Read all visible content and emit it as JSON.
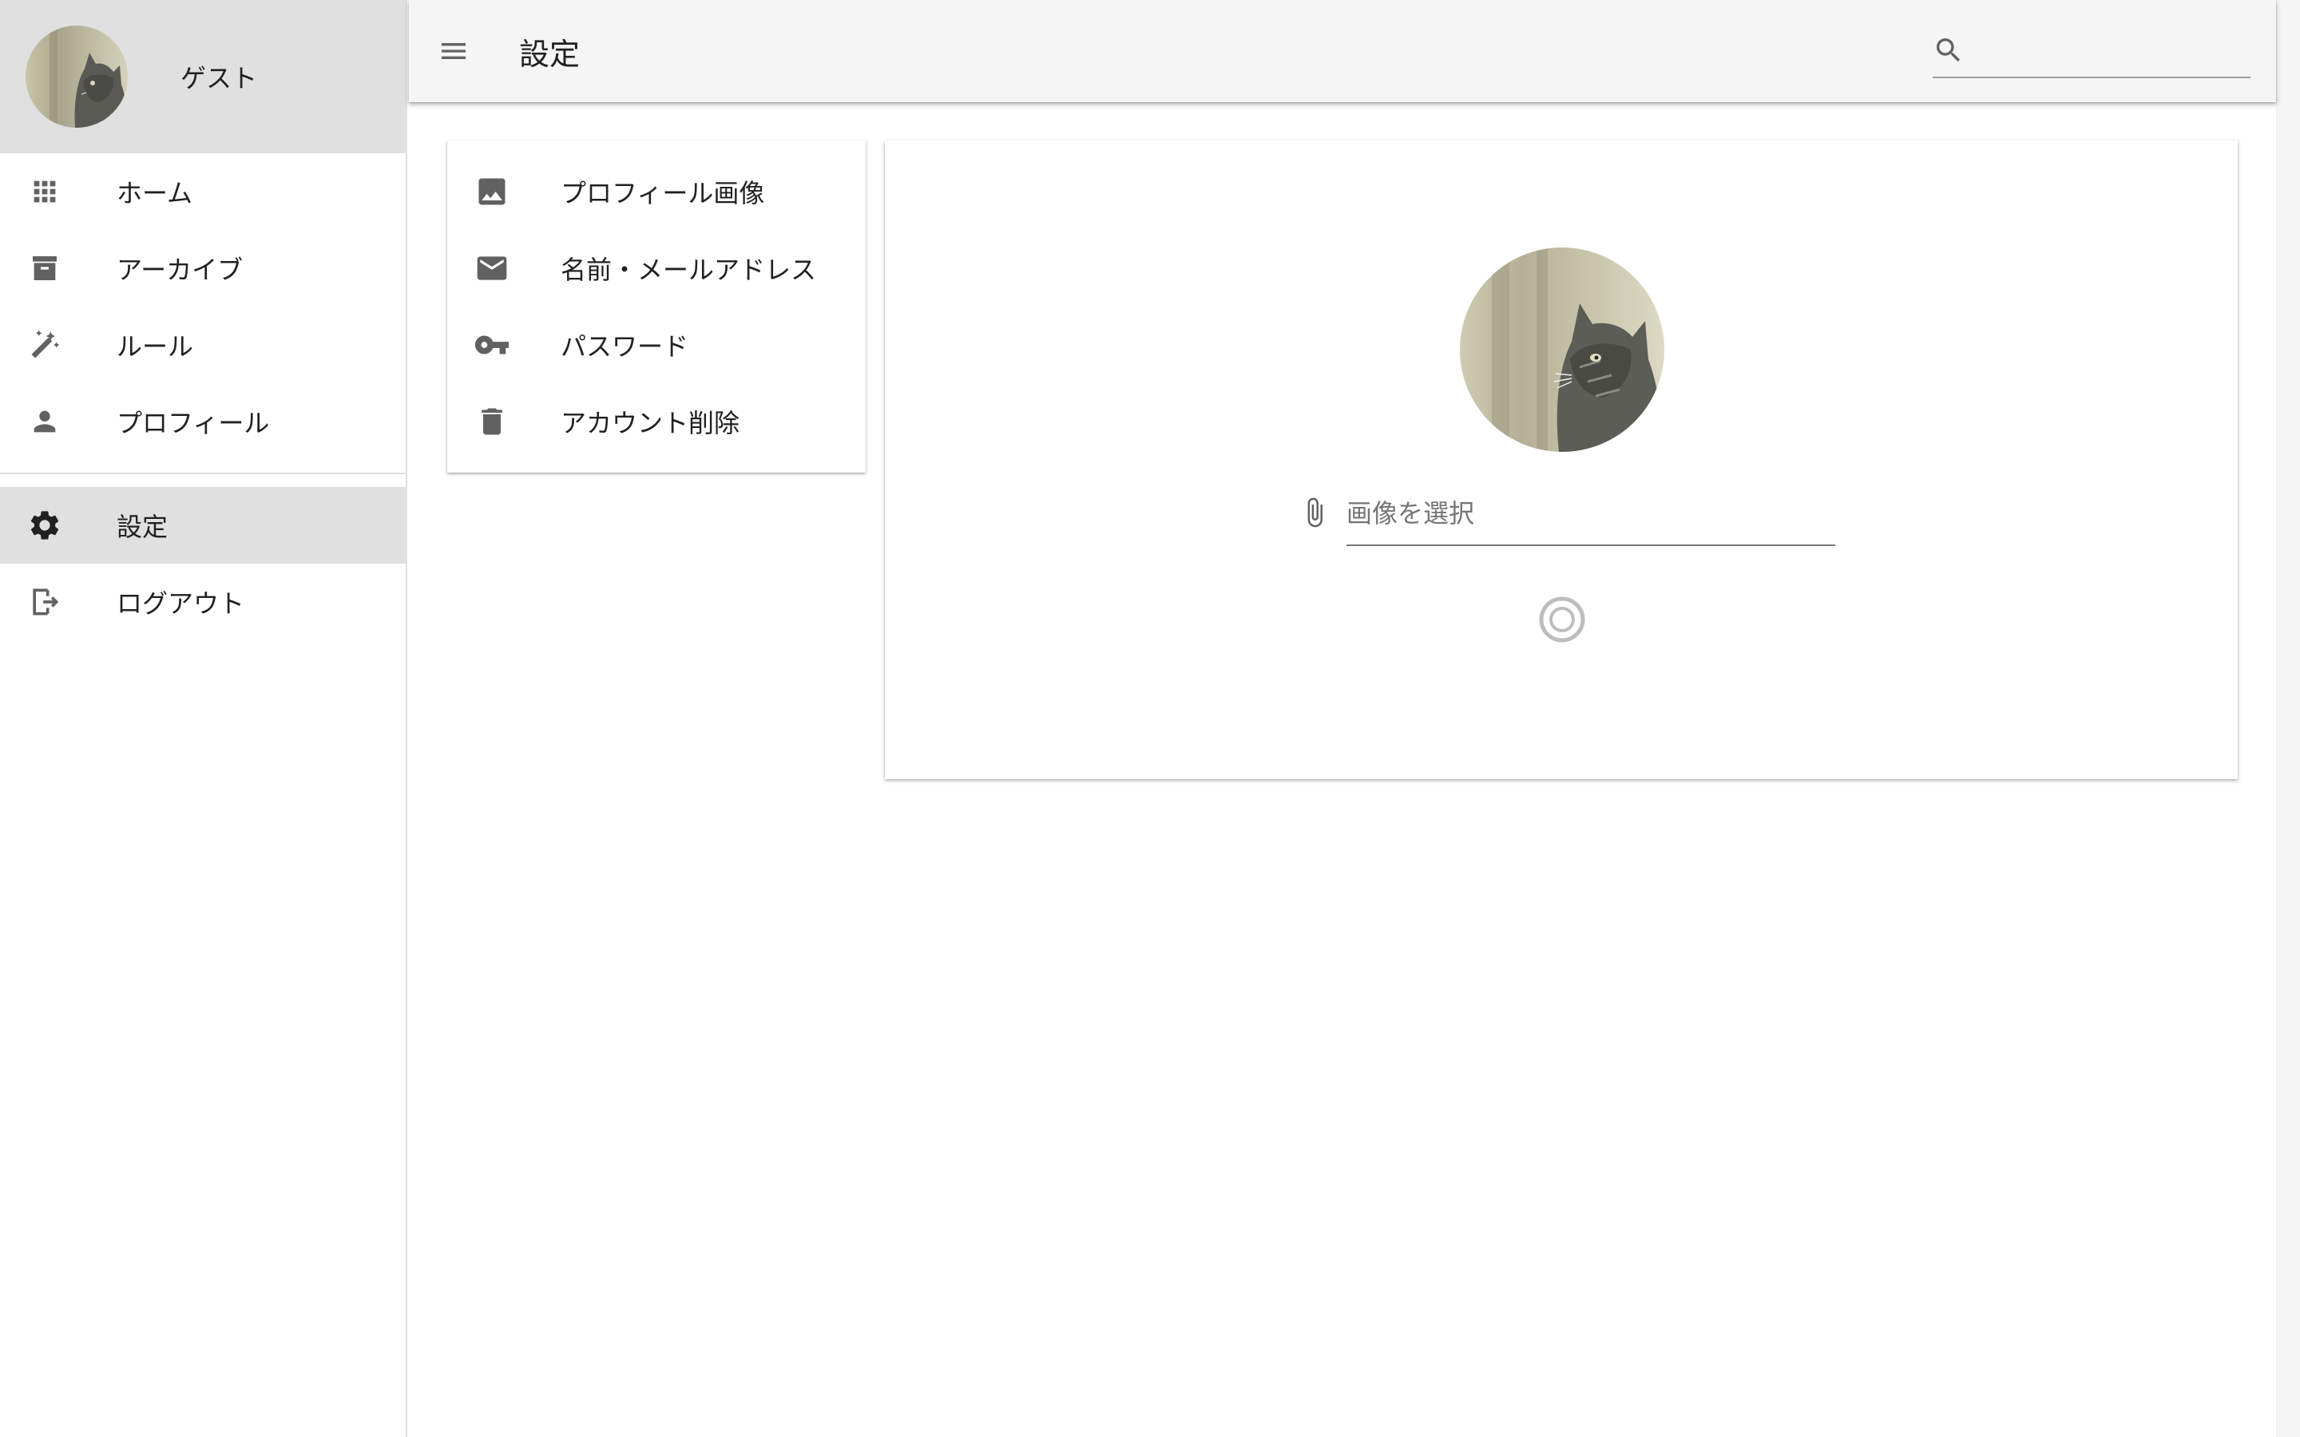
{
  "sidebar": {
    "user": {
      "name": "ゲスト"
    },
    "items": [
      {
        "label": "ホーム",
        "icon": "apps-grid-icon"
      },
      {
        "label": "アーカイブ",
        "icon": "archive-box-icon"
      },
      {
        "label": "ルール",
        "icon": "magic-wand-icon"
      },
      {
        "label": "プロフィール",
        "icon": "person-icon"
      },
      {
        "label": "設定",
        "icon": "gear-icon",
        "active": true
      },
      {
        "label": "ログアウト",
        "icon": "logout-icon"
      }
    ]
  },
  "appbar": {
    "title": "設定",
    "search_value": ""
  },
  "settings_menu": {
    "items": [
      {
        "label": "プロフィール画像",
        "icon": "image-icon"
      },
      {
        "label": "名前・メールアドレス",
        "icon": "mail-icon"
      },
      {
        "label": "パスワード",
        "icon": "key-icon"
      },
      {
        "label": "アカウント削除",
        "icon": "trash-icon"
      }
    ]
  },
  "profile_image_panel": {
    "file_placeholder": "画像を選択"
  },
  "colors": {
    "sidebar_header_bg": "#e0e0e0",
    "active_item_bg": "#e0e0e0",
    "appbar_bg": "#f5f5f5",
    "icon_gray": "#616161"
  }
}
